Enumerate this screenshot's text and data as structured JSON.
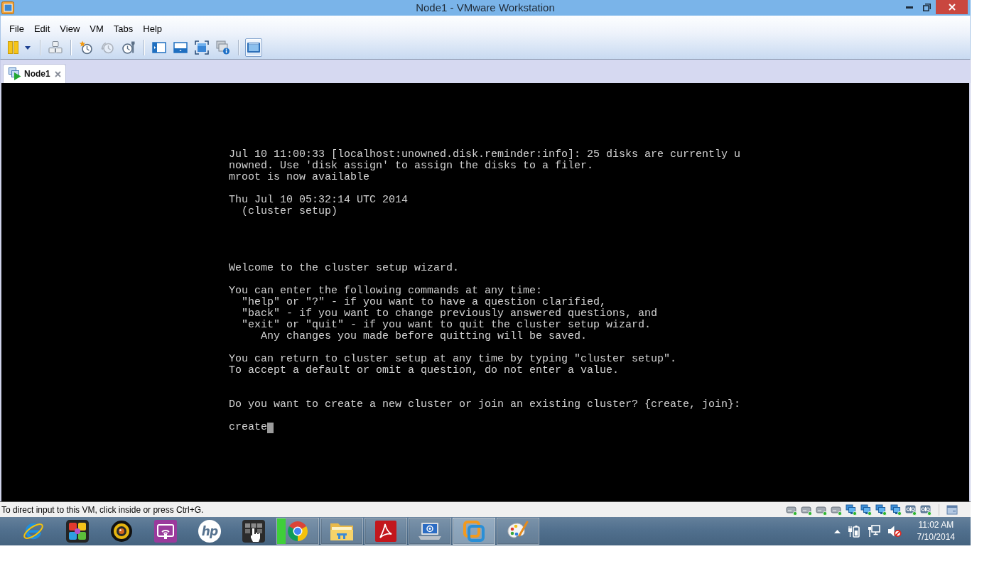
{
  "window": {
    "title": "Node1 - VMware Workstation"
  },
  "menu": [
    "File",
    "Edit",
    "View",
    "VM",
    "Tabs",
    "Help"
  ],
  "toolbar": [
    {
      "kind": "pause",
      "selected": false,
      "disabled": false
    },
    {
      "kind": "separator"
    },
    {
      "kind": "keys",
      "selected": false,
      "disabled": false
    },
    {
      "kind": "separator"
    },
    {
      "kind": "snapshot_take",
      "selected": false,
      "disabled": false
    },
    {
      "kind": "snapshot_revert",
      "selected": false,
      "disabled": true
    },
    {
      "kind": "snapshot_manager",
      "selected": false,
      "disabled": false
    },
    {
      "kind": "separator"
    },
    {
      "kind": "library_view",
      "selected": false,
      "disabled": false
    },
    {
      "kind": "thumbnail_bar",
      "selected": false,
      "disabled": false
    },
    {
      "kind": "full_screen",
      "selected": false,
      "disabled": false
    },
    {
      "kind": "unity",
      "selected": false,
      "disabled": false
    },
    {
      "kind": "separator"
    },
    {
      "kind": "console_view",
      "selected": true,
      "disabled": false
    }
  ],
  "tabs": [
    {
      "label": "Node1",
      "selected": true
    }
  ],
  "console": {
    "lines": [
      {
        "kind": "text",
        "text": "Jul 10 11:00:33 [localhost:unowned.disk.reminder:info]: 25 disks are currently u"
      },
      {
        "kind": "text",
        "text": "nowned. Use 'disk assign' to assign the disks to a filer."
      },
      {
        "kind": "text",
        "text": "mroot is now available"
      },
      {
        "kind": "blank"
      },
      {
        "kind": "text",
        "text": "Thu Jul 10 05:32:14 UTC 2014"
      },
      {
        "kind": "text",
        "text": "  (cluster setup)"
      },
      {
        "kind": "blank"
      },
      {
        "kind": "blank"
      },
      {
        "kind": "blank"
      },
      {
        "kind": "blank"
      },
      {
        "kind": "text",
        "text": "Welcome to the cluster setup wizard."
      },
      {
        "kind": "blank"
      },
      {
        "kind": "text",
        "text": "You can enter the following commands at any time:"
      },
      {
        "kind": "text",
        "text": "  \"help\" or \"?\" - if you want to have a question clarified,"
      },
      {
        "kind": "text",
        "text": "  \"back\" - if you want to change previously answered questions, and"
      },
      {
        "kind": "text",
        "text": "  \"exit\" or \"quit\" - if you want to quit the cluster setup wizard."
      },
      {
        "kind": "text",
        "text": "     Any changes you made before quitting will be saved."
      },
      {
        "kind": "blank"
      },
      {
        "kind": "text",
        "text": "You can return to cluster setup at any time by typing \"cluster setup\"."
      },
      {
        "kind": "text",
        "text": "To accept a default or omit a question, do not enter a value."
      },
      {
        "kind": "blank"
      },
      {
        "kind": "blank"
      },
      {
        "kind": "text",
        "text": "Do you want to create a new cluster or join an existing cluster? {create, join}:"
      },
      {
        "kind": "blank"
      },
      {
        "kind": "input",
        "text": "create",
        "cursor": true
      }
    ]
  },
  "status_bar": {
    "message": "To direct input to this VM, click inside or press Ctrl+G.",
    "devices": [
      {
        "kind": "disk",
        "connected": true
      },
      {
        "kind": "disk",
        "connected": true
      },
      {
        "kind": "disk",
        "connected": true
      },
      {
        "kind": "disk",
        "connected": true
      },
      {
        "kind": "network",
        "connected": true
      },
      {
        "kind": "network",
        "connected": true
      },
      {
        "kind": "network",
        "connected": true
      },
      {
        "kind": "network",
        "connected": true
      },
      {
        "kind": "port",
        "connected": true
      },
      {
        "kind": "port",
        "connected": true
      }
    ]
  },
  "taskbar": {
    "apps": [
      {
        "kind": "ebrowser",
        "running": false,
        "active": false
      },
      {
        "kind": "puzzle",
        "running": false,
        "active": false
      },
      {
        "kind": "webcam",
        "running": false,
        "active": false
      },
      {
        "kind": "cast",
        "running": false,
        "active": false
      },
      {
        "kind": "logo",
        "logo_text": "hp",
        "running": false,
        "active": false
      },
      {
        "kind": "touch",
        "running": false,
        "active": false
      },
      {
        "kind": "wheel",
        "running": true,
        "active": false,
        "level": 0.2
      },
      {
        "kind": "folder",
        "running": true,
        "active": false
      },
      {
        "kind": "pdf",
        "running": true,
        "active": false
      },
      {
        "kind": "laptop",
        "running": true,
        "active": false
      },
      {
        "kind": "squares",
        "running": true,
        "active": true
      },
      {
        "kind": "palette",
        "running": true,
        "active": false
      }
    ],
    "tray": {
      "volume_muted": true,
      "time": "11:02 AM",
      "date": "7/10/2014"
    }
  }
}
